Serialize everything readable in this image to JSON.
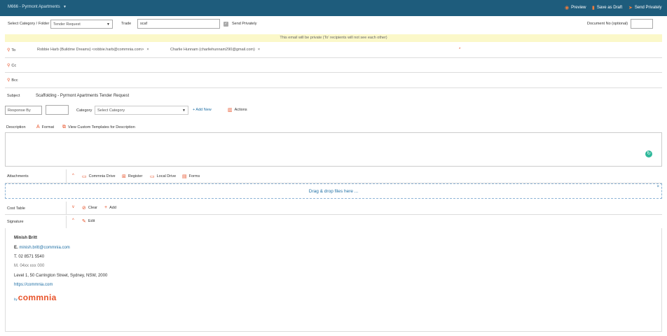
{
  "topbar": {
    "title": "M666 - Pyrmont Apartments",
    "preview": "Preview",
    "save_draft": "Save as Draft",
    "send_privately": "Send Privately"
  },
  "row1": {
    "category_label": "Select Category / Folder",
    "category_value": "Tender Request",
    "trade_label": "Trade",
    "trade_value": "scaf",
    "send_privately_label": "Send Privately",
    "document_no_label": "Document No (optional)",
    "document_no_value": ""
  },
  "private_notice": "This email will be private (To' recipients will not see each other)",
  "to": {
    "label": "To",
    "recipients": [
      "Robbie Harb (Buildme Dreams) <robbie.harb@commnia.com>",
      "Charlie Hunnam (charliehunnam290@gmail.com)"
    ],
    "required_mark": "*"
  },
  "cc": {
    "label": "Cc"
  },
  "bcc": {
    "label": "Bcc"
  },
  "subject": {
    "label": "Subject",
    "value": "Scaffolding - Pyrmont Apartments Tender Request"
  },
  "response": {
    "respond_by_label": "Response By",
    "respond_by_value": "",
    "category_label": "Category",
    "category_placeholder": "Select Category",
    "add_new": "+ Add New",
    "actions": "Actions"
  },
  "description": {
    "label": "Description",
    "format": "Format",
    "custom_templates": "View Custom Templates for Description"
  },
  "attachments": {
    "label": "Attachments",
    "commnia_drive": "Commnia Drive",
    "register": "Register",
    "local_drive": "Local Drive",
    "forms": "Forms",
    "dropzone": "Drag & drop files here ..."
  },
  "cost_table": {
    "label": "Cost Table",
    "clear": "Clear",
    "add": "Add"
  },
  "signature": {
    "label": "Signature",
    "edit": "Edit",
    "name": "Minish Britt",
    "email_prefix": "E.",
    "email": "minish.britt@commnia.com",
    "phone": "T. 02 8571 5540",
    "mobile": "M. 04xx xxx 000",
    "address": "Level 1, 50 Carrington Street, Sydney, NSW, 2000",
    "website": "https://commnia.com",
    "logo_by": "by",
    "logo_text": "commnia"
  },
  "colors": {
    "topbar": "#1e5c7c",
    "accent": "#e8532a",
    "link": "#1f6fa5",
    "notice_bg": "#fbf8c9",
    "teal": "#2eb89a"
  }
}
